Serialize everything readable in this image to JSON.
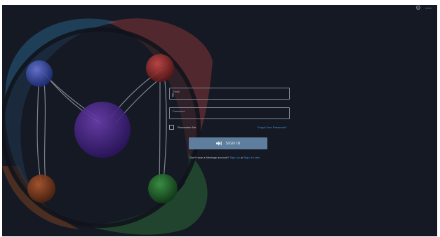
{
  "window": {
    "controls": {
      "settings_glyph": "⚙",
      "minimize_glyph": "—"
    }
  },
  "login": {
    "email_placeholder": "Email",
    "password_placeholder": "Password",
    "remember_label": "Remember Me",
    "forgot_label": "Forgot Your Password?",
    "signin_label": "SIGN IN",
    "signin_icon": "sign-in-icon",
    "no_account_text": "Don't have a Mentage account?",
    "signup_label": "Sign Up",
    "or_text": "or",
    "signin_later_label": "Sign In Later"
  },
  "colors": {
    "background": "#151923",
    "accent_link": "#3d9be0",
    "signin_button": "#5f7e9d",
    "field_border": "#7d8593"
  },
  "logo": {
    "icon": "molecule-logo-icon"
  }
}
